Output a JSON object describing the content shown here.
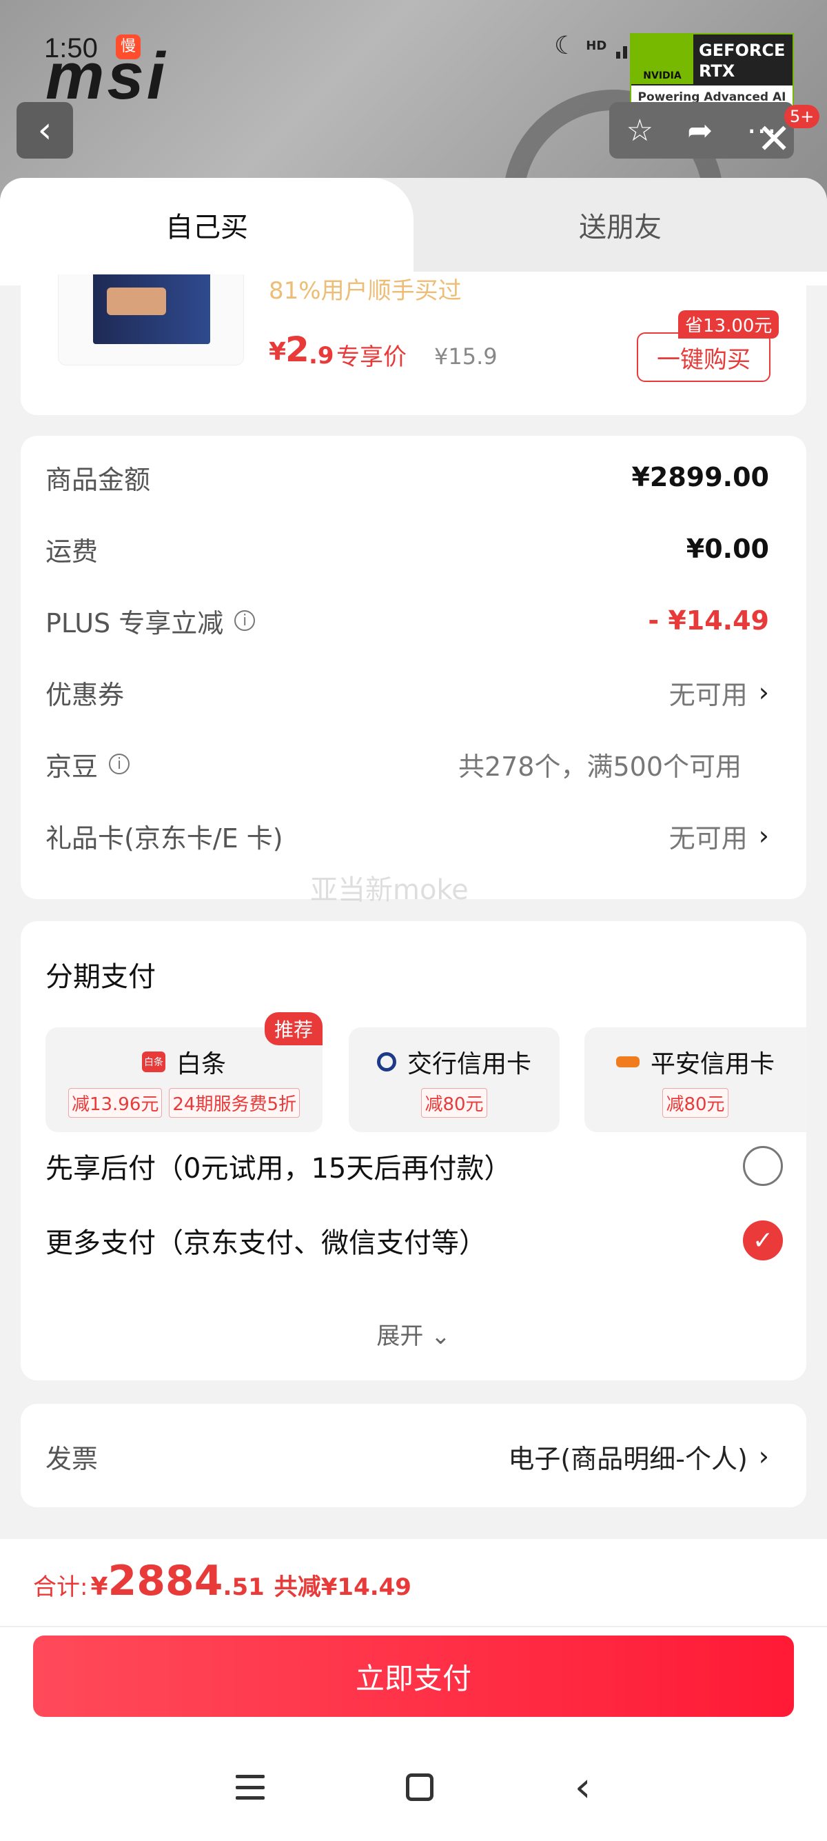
{
  "status_bar": {
    "time": "1:50",
    "app_badge": "慢",
    "network": "HD"
  },
  "background_app": {
    "logo": "msi",
    "nvidia": {
      "brand": "NVIDIA",
      "product_line1": "GEFORCE",
      "product_line2": "RTX",
      "tagline": "Powering Advanced AI"
    },
    "notification_badge": "5+"
  },
  "tabs": [
    {
      "label": "自己买",
      "active": true
    },
    {
      "label": "送朋友",
      "active": false
    }
  ],
  "product": {
    "promo_text": "81%用户顺手买过",
    "price_currency": "¥",
    "price_int": "2",
    "price_dec": ".9",
    "price_tag": "专享价",
    "original_price": "¥15.9",
    "save_tag": "省13.00元",
    "buy_button": "一键购买"
  },
  "summary": {
    "rows": [
      {
        "label": "商品金额",
        "value": "¥2899.00"
      },
      {
        "label": "运费",
        "value": "¥0.00"
      },
      {
        "label": "PLUS 专享立减",
        "value": "- ¥14.49"
      },
      {
        "label": "优惠券",
        "value": "无可用"
      },
      {
        "label": "京豆",
        "value": "共278个，满500个可用"
      },
      {
        "label": "礼品卡(京东卡/E 卡)",
        "value": "无可用"
      }
    ]
  },
  "watermark": "亚当新moke",
  "installment": {
    "title": "分期支付",
    "plans": [
      {
        "name": "白条",
        "logo_text": "白条",
        "tags": [
          "减13.96元",
          "24期服务费5折"
        ],
        "recommend": "推荐"
      },
      {
        "name": "交行信用卡",
        "tags": [
          "减80元"
        ]
      },
      {
        "name": "平安信用卡",
        "tags": [
          "减80元"
        ]
      }
    ],
    "pay_options": [
      {
        "label": "先享后付（0元试用，15天后再付款）",
        "checked": false
      },
      {
        "label": "更多支付（京东支付、微信支付等）",
        "checked": true
      }
    ],
    "expand_label": "展开",
    "check_mark": "✓"
  },
  "invoice": {
    "label": "发票",
    "value": "电子(商品明细-个人)"
  },
  "footer": {
    "total_label": "合计:",
    "total_currency": "¥",
    "total_int": "2884",
    "total_dec": ".51",
    "total_saving": "共减¥14.49",
    "pay_button": "立即支付"
  },
  "colors": {
    "accent": "#e93a3a",
    "pay_gradient_start": "#ff4a5a",
    "pay_gradient_end": "#ff1a36"
  },
  "icons": {
    "back": "chevron-left-icon",
    "favorite": "star-icon",
    "share": "share-icon",
    "more": "more-icon",
    "close": "close-icon",
    "info": "info-icon",
    "chevron": "chevron-right-icon"
  }
}
